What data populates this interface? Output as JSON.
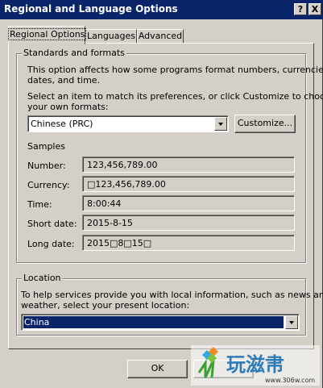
{
  "window": {
    "title": "Regional and Language Options",
    "help_label": "?",
    "close_label": "X"
  },
  "tabs": [
    {
      "label": "Regional Options"
    },
    {
      "label": "Languages"
    },
    {
      "label": "Advanced"
    }
  ],
  "standards": {
    "group_title": "Standards and formats",
    "description": [
      "This option affects how some programs format numbers, currencies,",
      "dates, and time."
    ],
    "instruction": [
      "Select an item to match its preferences, or click Customize to choose",
      "your own formats:"
    ],
    "format_select": "Chinese (PRC)",
    "customize_label": "Customize..."
  },
  "samples": {
    "heading": "Samples",
    "rows": [
      {
        "label": "Number:",
        "value": "123,456,789.00"
      },
      {
        "label": "Currency:",
        "value": "□123,456,789.00"
      },
      {
        "label": "Time:",
        "value": "8:00:44"
      },
      {
        "label": "Short date:",
        "value": "2015-8-15"
      },
      {
        "label": "Long date:",
        "value": "2015□8□15□"
      }
    ]
  },
  "location": {
    "group_title": "Location",
    "description": [
      "To help services provide you with local information, such as news and",
      "weather, select your present location:"
    ],
    "select_value": "China"
  },
  "footer": {
    "ok_label": "OK"
  },
  "watermark": {
    "text": "玩滋帇",
    "url": "www.306w.com"
  }
}
